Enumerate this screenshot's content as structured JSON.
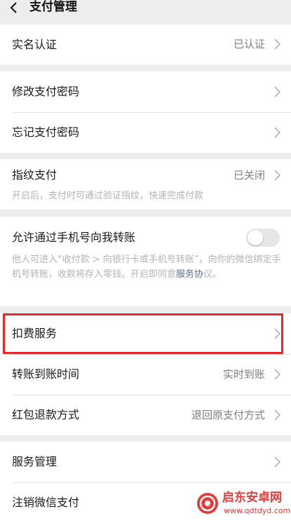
{
  "header": {
    "title": "支付管理",
    "back_icon": "chevron-left-icon"
  },
  "sections": {
    "verification": {
      "real_name": {
        "label": "实名认证",
        "value": "已认证"
      }
    },
    "password": {
      "change": {
        "label": "修改支付密码"
      },
      "forgot": {
        "label": "忘记支付密码"
      }
    },
    "fingerprint": {
      "label": "指纹支付",
      "value": "已关闭",
      "description": "开启后，支付时可通过验证指纹，快速完成付款"
    },
    "phone_transfer": {
      "label": "允许通过手机号向我转账",
      "enabled": false,
      "description": "他人可进入“收付款 > 向银行卡或手机号转账”，向你的微信绑定手机号转账，收款将存入零钱。开启即同意",
      "link_text": "服务协",
      "description_tail": "议。"
    },
    "services": {
      "deduction": {
        "label": "扣费服务"
      },
      "transfer_time": {
        "label": "转账到账时间",
        "value": "实时到账"
      },
      "red_packet_refund": {
        "label": "红包退款方式",
        "value": "退回原支付方式"
      }
    },
    "management": {
      "service_manage": {
        "label": "服务管理"
      },
      "cancel_wechat_pay": {
        "label": "注销微信支付"
      }
    }
  },
  "watermark": {
    "name": "启东安卓网",
    "url": "www.qdtdyd.com"
  },
  "colors": {
    "background": "#ededed",
    "card": "#ffffff",
    "highlight": "#e12a2a",
    "link": "#576b95",
    "secondary_text": "#7d7d7d",
    "hint_text": "#b3b3b3"
  }
}
